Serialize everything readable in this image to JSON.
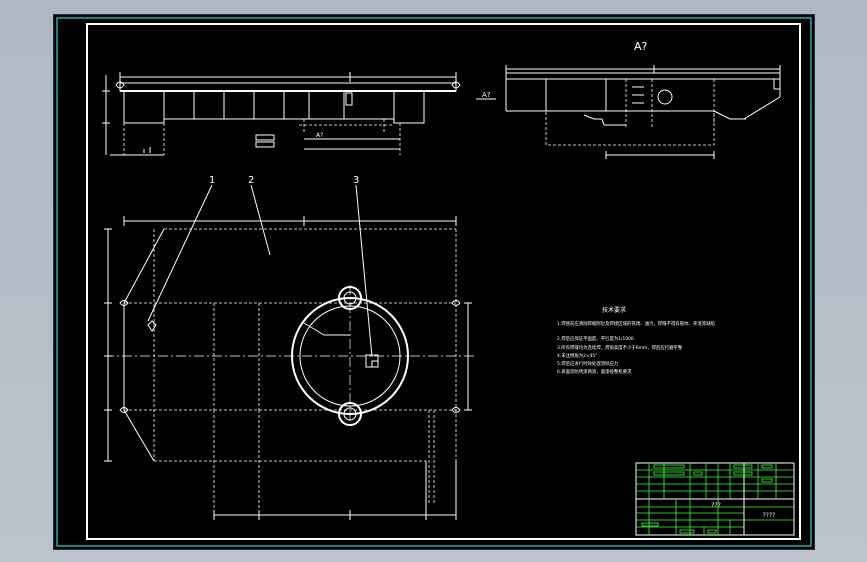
{
  "drawing": {
    "view_label": "A?",
    "section_marker": "A?",
    "part_labels": [
      "1",
      "2",
      "3"
    ],
    "notes_title": "技术要求",
    "notes": [
      "1.焊接前应清除焊缝附近及焊接区域的铁锈、油污，焊缝不得有裂纹、夹渣等缺陷",
      "2.焊后应保证平面度、平行度为1/1000",
      "3.所有焊缝均为连续焊，焊角高度不小于6mm，焊后应打磨平整",
      "4.未注倒角为2×45°",
      "5.焊后应进行时效处理消除应力",
      "6.表面涂防锈漆两道，面漆按整机要求"
    ],
    "title_block": {
      "drawing_name": "???",
      "drawing_code": "????"
    }
  }
}
